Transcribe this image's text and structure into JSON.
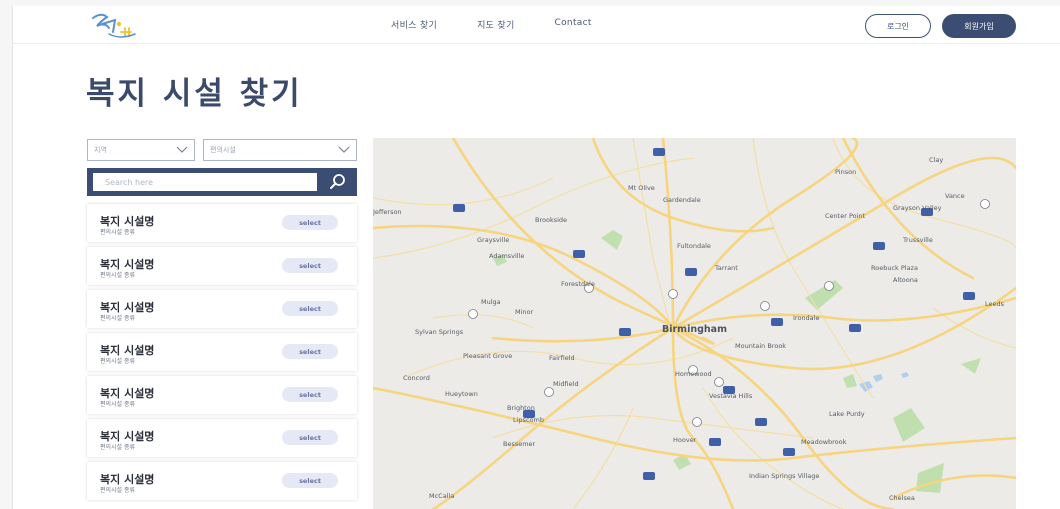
{
  "header": {
    "nav": [
      "서비스 찾기",
      "지도 찾기",
      "Contact"
    ],
    "login_label": "로그인",
    "signup_label": "회원가입"
  },
  "page": {
    "title": "복지 시설 찾기"
  },
  "filters": {
    "region": "지역",
    "type": "편의시설"
  },
  "search": {
    "placeholder": "Search here"
  },
  "facilities": [
    {
      "name": "복지 시설명",
      "type": "편의시설 종류",
      "button": "select"
    },
    {
      "name": "복지 시설명",
      "type": "편의시설 종류",
      "button": "select"
    },
    {
      "name": "복지 시설명",
      "type": "편의시설 종류",
      "button": "select"
    },
    {
      "name": "복지 시설명",
      "type": "편의시설 종류",
      "button": "select"
    },
    {
      "name": "복지 시설명",
      "type": "편의시설 종류",
      "button": "select"
    },
    {
      "name": "복지 시설명",
      "type": "편의시설 종류",
      "button": "select"
    },
    {
      "name": "복지 시설명",
      "type": "편의시설 종류",
      "button": "select"
    }
  ],
  "map": {
    "labels": [
      "Birmingham",
      "Mt Olive",
      "Gardendale",
      "Pinson",
      "Clay",
      "Grayson Valley",
      "Center Point",
      "Trussville",
      "Brookside",
      "Graysville",
      "Adamsville",
      "Fultondale",
      "Tarrant",
      "Roebuck Plaza",
      "Center Point",
      "Forestdale",
      "Mulga",
      "Minor",
      "Sylvan Springs",
      "Pleasant Grove",
      "Fairfield",
      "Midfield",
      "Concord",
      "Hueytown",
      "Homewood",
      "Vestavia Hills",
      "Mountain Brook",
      "Irondale",
      "Lake Purdy",
      "Bessemer",
      "Hoover",
      "Meadowbrook",
      "Indian Springs Village",
      "McCalla",
      "Chelsea",
      "Jefferson",
      "Leeds",
      "Vance",
      "Altoona",
      "Brighton",
      "Lipscomb"
    ]
  },
  "colors": {
    "primary": "#3b4d73",
    "title": "#3b4a6b",
    "select_bg": "#e5e9f6",
    "map_bg": "#ecebe8",
    "road": "#f7d47f",
    "park": "#b9dea5",
    "water": "#a9cdf0"
  },
  "icons": [
    "logo-mark",
    "chevron-down-icon",
    "search-icon"
  ]
}
